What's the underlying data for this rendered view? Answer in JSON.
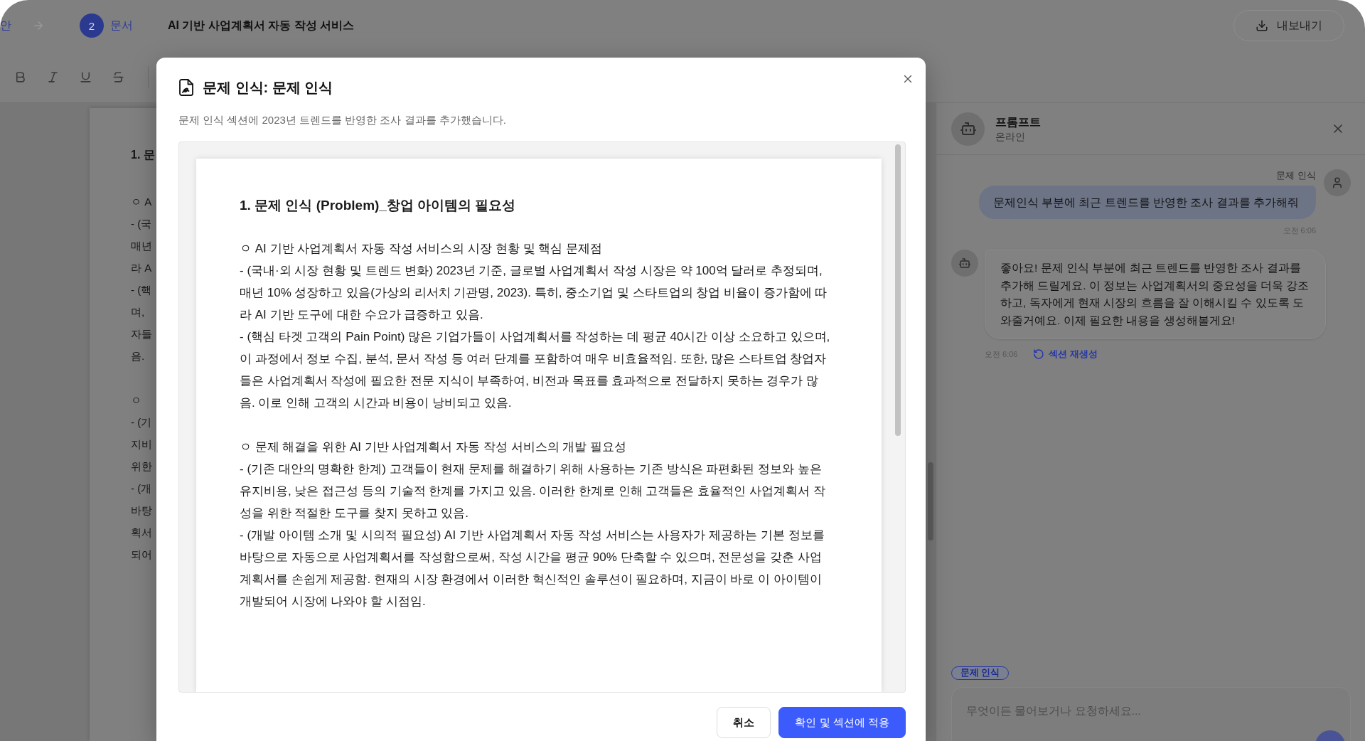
{
  "header": {
    "steps": [
      {
        "label": "안"
      },
      {
        "number": "2",
        "label": "문서"
      }
    ],
    "title": "AI 기반 사업계획서 자동 작성 서비스",
    "export_button": "내보내기"
  },
  "document": {
    "heading": "1. 문",
    "sections": [
      [
        "ㅇ A",
        "- (국",
        "매년",
        "라 A",
        "- (핵",
        "며,",
        "자들",
        "음."
      ],
      [
        "ㅇ",
        "- (기",
        "지비",
        "위한",
        "- (개",
        "바탕",
        "획서",
        "되어"
      ]
    ]
  },
  "dialog": {
    "title": "문제 인식: 문제 인식",
    "description": "문제 인식 섹션에 2023년 트렌드를 반영한 조사 결과를 추가했습니다.",
    "preview": {
      "heading": "1. 문제 인식 (Problem)_창업 아이템의 필요성",
      "sections": [
        {
          "title": "ㅇ AI 기반 사업계획서 자동 작성 서비스의 시장 현황 및 핵심 문제점",
          "items": [
            "- (국내·외 시장 현황 및 트렌드 변화) 2023년 기준, 글로벌 사업계획서 작성 시장은 약 100억 달러로 추정되며, 매년 10% 성장하고 있음(가상의 리서치 기관명, 2023). 특히, 중소기업 및 스타트업의 창업 비율이 증가함에 따라 AI 기반 도구에 대한 수요가 급증하고 있음.",
            "- (핵심 타겟 고객의 Pain Point) 많은 기업가들이 사업계획서를 작성하는 데 평균 40시간 이상 소요하고 있으며, 이 과정에서 정보 수집, 분석, 문서 작성 등 여러 단계를 포함하여 매우 비효율적임. 또한, 많은 스타트업 창업자들은 사업계획서 작성에 필요한 전문 지식이 부족하여, 비전과 목표를 효과적으로 전달하지 못하는 경우가 많음. 이로 인해 고객의 시간과 비용이 낭비되고 있음."
          ]
        },
        {
          "title": "ㅇ 문제 해결을 위한 AI 기반 사업계획서 자동 작성 서비스의 개발 필요성",
          "items": [
            "- (기존 대안의 명확한 한계) 고객들이 현재 문제를 해결하기 위해 사용하는 기존 방식은 파편화된 정보와 높은 유지비용, 낮은 접근성 등의 기술적 한계를 가지고 있음. 이러한 한계로 인해 고객들은 효율적인 사업계획서 작성을 위한 적절한 도구를 찾지 못하고 있음.",
            "- (개발 아이템 소개 및 시의적 필요성) AI 기반 사업계획서 자동 작성 서비스는 사용자가 제공하는 기본 정보를 바탕으로 자동으로 사업계획서를 작성함으로써, 작성 시간을 평균 90% 단축할 수 있으며, 전문성을 갖춘 사업계획서를 손쉽게 제공함. 현재의 시장 환경에서 이러한 혁신적인 솔루션이 필요하며, 지금이 바로 이 아이템이 개발되어 시장에 나와야 할 시점임."
          ]
        }
      ]
    },
    "buttons": [
      {
        "label": "취소",
        "kind": "secondary"
      },
      {
        "label": "확인 및 섹션에 적용",
        "kind": "primary"
      }
    ]
  },
  "assistant_panel": {
    "name": "프롬프트",
    "status": "온라인",
    "messages": [
      {
        "kind": "user",
        "tag": "문제 인식",
        "text": "문제인식 부분에 최근 트렌드를 반영한 조사 결과를 추가해줘",
        "time": "오전 6:06"
      },
      {
        "kind": "assistant",
        "text": "좋아요! 문제 인식 부분에 최근 트렌드를 반영한 조사 결과를 추가해 드릴게요. 이 정보는 사업계획서의 중요성을 더욱 강조하고, 독자에게 현재 시장의 흐름을 잘 이해시킬 수 있도록 도와줄거예요. 이제 필요한 내용을 생성해볼게요!",
        "time": "오전 6:06",
        "action": "섹션 재생성"
      }
    ],
    "context_chip": "문제 인식",
    "input": {
      "placeholder": "무엇이든 물어보거나 요청하세요..."
    }
  }
}
